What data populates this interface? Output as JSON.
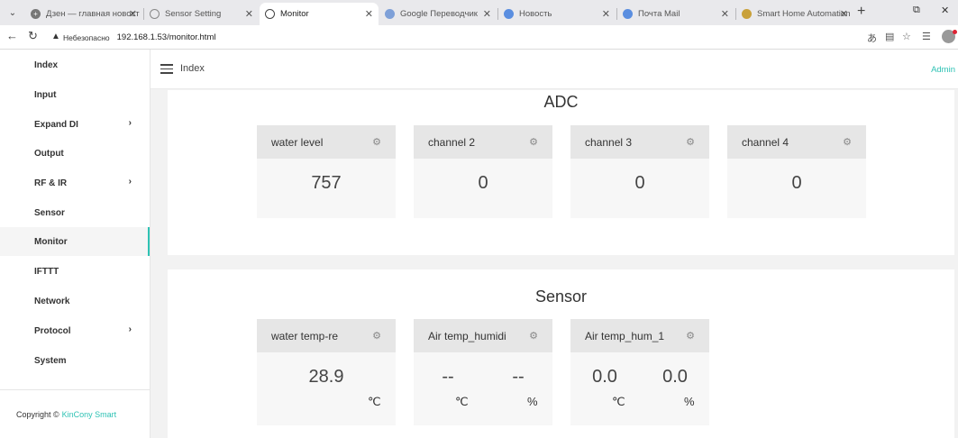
{
  "browser": {
    "tabs": [
      {
        "title": "Дзен — главная новост",
        "active": false
      },
      {
        "title": "Sensor Setting",
        "active": false
      },
      {
        "title": "Monitor",
        "active": true
      },
      {
        "title": "Google Переводчик",
        "active": false
      },
      {
        "title": "Новость",
        "active": false
      },
      {
        "title": "Почта Mail",
        "active": false
      },
      {
        "title": "Smart Home Automation",
        "active": false
      }
    ],
    "insecure_label": "Небезопасно",
    "url": "192.168.1.53/monitor.html"
  },
  "sidebar": {
    "items": [
      {
        "label": "Index",
        "has_submenu": false
      },
      {
        "label": "Input",
        "has_submenu": false
      },
      {
        "label": "Expand DI",
        "has_submenu": true
      },
      {
        "label": "Output",
        "has_submenu": false
      },
      {
        "label": "RF & IR",
        "has_submenu": true
      },
      {
        "label": "Sensor",
        "has_submenu": false
      },
      {
        "label": "Monitor",
        "has_submenu": false,
        "active": true
      },
      {
        "label": "IFTTT",
        "has_submenu": false
      },
      {
        "label": "Network",
        "has_submenu": false
      },
      {
        "label": "Protocol",
        "has_submenu": true
      },
      {
        "label": "System",
        "has_submenu": false
      }
    ],
    "footer_prefix": "Copyright ©",
    "footer_brand": "KinCony Smart"
  },
  "header": {
    "breadcrumb": "Index",
    "user": "Admin"
  },
  "adc": {
    "title": "ADC",
    "cards": [
      {
        "name": "water level",
        "value": "757"
      },
      {
        "name": "channel 2",
        "value": "0"
      },
      {
        "name": "channel 3",
        "value": "0"
      },
      {
        "name": "channel 4",
        "value": "0"
      }
    ]
  },
  "sensor": {
    "title": "Sensor",
    "cards": [
      {
        "name": "water temp-re",
        "temp": "28.9",
        "temp_unit": "℃"
      },
      {
        "name": "Air temp_humidi",
        "temp": "--",
        "temp_unit": "℃",
        "hum": "--",
        "hum_unit": "%"
      },
      {
        "name": "Air temp_hum_1",
        "temp": "0.0",
        "temp_unit": "℃",
        "hum": "0.0",
        "hum_unit": "%"
      }
    ]
  },
  "colors": {
    "accent": "#2ec2b4",
    "card_header": "#e6e6e6",
    "card_body": "#f7f7f7"
  }
}
